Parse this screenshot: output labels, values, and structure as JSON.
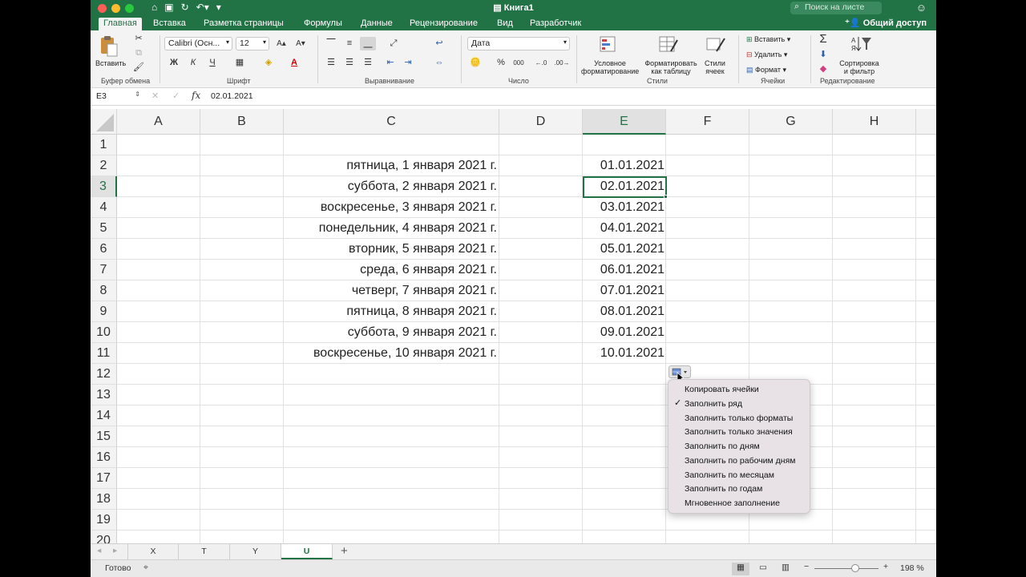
{
  "window": {
    "title": "Книга1",
    "search_placeholder": "Поиск на листе",
    "share_label": "Общий доступ"
  },
  "tabs": [
    "Главная",
    "Вставка",
    "Разметка страницы",
    "Формулы",
    "Данные",
    "Рецензирование",
    "Вид",
    "Разработчик"
  ],
  "ribbon": {
    "clipboard": {
      "paste": "Вставить",
      "label": "Буфер обмена"
    },
    "font": {
      "name": "Calibri (Осн...",
      "size": "12",
      "bold": "Ж",
      "italic": "К",
      "underline": "Ч",
      "label": "Шрифт"
    },
    "alignment": {
      "label": "Выравнивание"
    },
    "number": {
      "format": "Дата",
      "percent": "%",
      "thousands": "000",
      "label": "Число"
    },
    "styles": {
      "conditional_1": "Условное",
      "conditional_2": "форматирование",
      "table_1": "Форматировать",
      "table_2": "как таблицу",
      "cell_1": "Стили",
      "cell_2": "ячеек",
      "label": "Стили"
    },
    "cells": {
      "insert": "Вставить",
      "delete": "Удалить",
      "format": "Формат",
      "label": "Ячейки"
    },
    "editing": {
      "sort_1": "Сортировка",
      "sort_2": "и фильтр",
      "label": "Редактирование"
    }
  },
  "formula_bar": {
    "name_box": "E3",
    "fx": "fx",
    "content": "02.01.2021"
  },
  "columns": [
    "A",
    "B",
    "C",
    "D",
    "E",
    "F",
    "G",
    "H"
  ],
  "rows": [
    "1",
    "2",
    "3",
    "4",
    "5",
    "6",
    "7",
    "8",
    "9",
    "10",
    "11",
    "12",
    "13",
    "14",
    "15",
    "16",
    "17",
    "18",
    "19",
    "20"
  ],
  "cells": {
    "C": [
      "",
      "пятница, 1 января 2021 г.",
      "суббота, 2 января 2021 г.",
      "воскресенье, 3 января 2021 г.",
      "понедельник, 4 января 2021 г.",
      "вторник, 5 января 2021 г.",
      "среда, 6 января 2021 г.",
      "четверг, 7 января 2021 г.",
      "пятница, 8 января 2021 г.",
      "суббота, 9 января 2021 г.",
      "воскресенье, 10 января 2021 г."
    ],
    "E": [
      "",
      "01.01.2021",
      "02.01.2021",
      "03.01.2021",
      "04.01.2021",
      "05.01.2021",
      "06.01.2021",
      "07.01.2021",
      "08.01.2021",
      "09.01.2021",
      "10.01.2021"
    ]
  },
  "autofill_menu": {
    "items": [
      "Копировать ячейки",
      "Заполнить ряд",
      "Заполнить только форматы",
      "Заполнить только значения",
      "Заполнить по дням",
      "Заполнить по рабочим дням",
      "Заполнить по месяцам",
      "Заполнить по годам",
      "Мгновенное заполнение"
    ],
    "checked": "✓"
  },
  "sheets": [
    "X",
    "T",
    "Y",
    "U"
  ],
  "active_sheet": "U",
  "status": {
    "ready": "Готово",
    "zoom": "198 %"
  },
  "colors": {
    "accent": "#217346"
  }
}
